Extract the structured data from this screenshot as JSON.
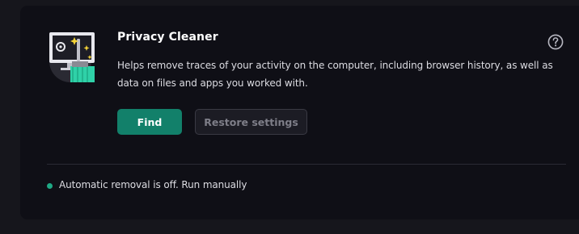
{
  "card": {
    "title": "Privacy Cleaner",
    "description": "Helps remove traces of your activity on the computer, including browser history, as well as data on files and apps you worked with.",
    "help_icon": "question-circle-icon",
    "illustration_icon": "privacy-cleaner-broom-monitor-icon"
  },
  "buttons": {
    "find_label": "Find",
    "restore_label": "Restore settings"
  },
  "status": {
    "text": "Automatic removal is off. Run manually",
    "dot_color": "#1fa985"
  },
  "colors": {
    "accent": "#12806a",
    "background": "#0f0f16"
  }
}
